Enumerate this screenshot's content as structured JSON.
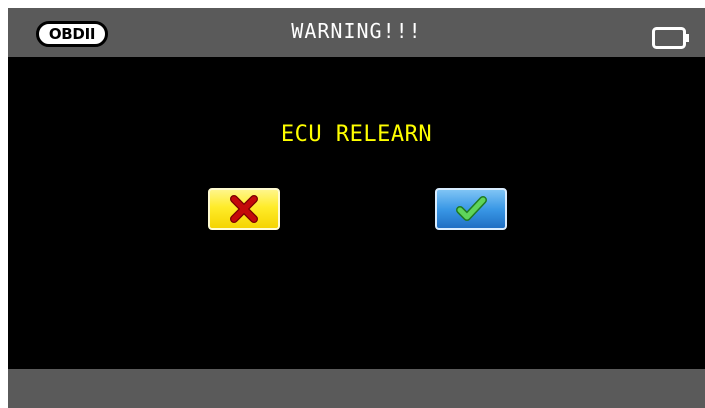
{
  "header": {
    "badge_label": "OBDII",
    "title": "WARNING!!!",
    "battery_icon": "battery-icon"
  },
  "main": {
    "prompt": "ECU RELEARN"
  },
  "actions": {
    "cancel_icon": "x-cross-icon",
    "confirm_icon": "checkmark-icon"
  },
  "colors": {
    "screen_background": "#000000",
    "bar_background": "#5a5a5a",
    "prompt_text": "#ffff00",
    "title_text": "#ffffff",
    "cancel_button": "#ffec2a",
    "cancel_icon": "#b00000",
    "confirm_button": "#3a98e6",
    "confirm_icon": "#4cc44a"
  }
}
